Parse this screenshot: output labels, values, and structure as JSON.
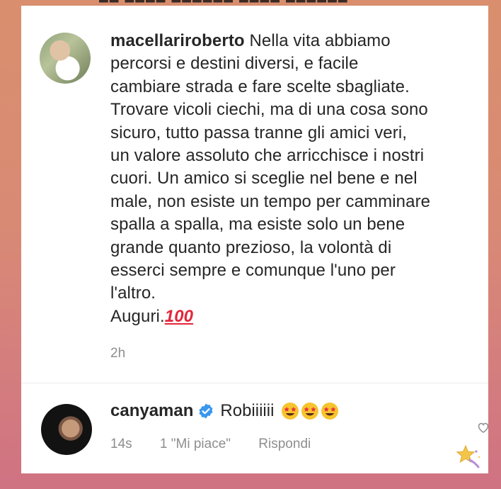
{
  "comment": {
    "username": "macellariroberto",
    "lines": [
      "Nella vita abbiamo",
      "percorsi e destini diversi, e facile",
      "cambiare strada e fare scelte sbagliate.",
      "Trovare vicoli ciechi, ma di una cosa sono",
      "sicuro, tutto passa tranne gli amici veri,",
      "un valore assoluto che arricchisce i nostri",
      "cuori. Un amico si sceglie nel bene e nel",
      "male, non esiste un tempo per camminare",
      "spalla a spalla, ma esiste solo un bene",
      "grande quanto prezioso, la volontà di",
      "esserci sempre e comunque l'uno per",
      "l'altro."
    ],
    "closing": "Auguri.",
    "closing_emoji": "💯",
    "time": "2h"
  },
  "reply": {
    "username": "canyaman",
    "verified_icon": "verified-badge-icon",
    "text": "Robiiiiii",
    "emoji_icon": "star-struck-emoji-icon",
    "emoji_count": 3,
    "time": "14s",
    "likes": "1 \"Mi piace\"",
    "reply_label": "Rispondi"
  },
  "colors": {
    "text": "#262626",
    "meta": "#8e8e8e",
    "verified": "#3897f0"
  }
}
